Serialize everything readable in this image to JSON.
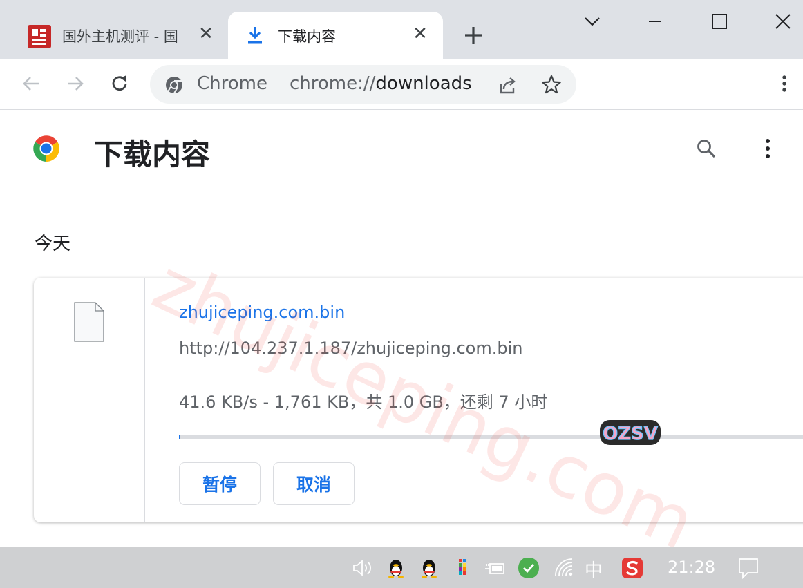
{
  "tabs": [
    {
      "title": "国外主机测评 - 国",
      "close": "✕",
      "active": false
    },
    {
      "title": "下载内容",
      "close": "✕",
      "active": true
    }
  ],
  "toolbar": {
    "chip_label": "Chrome",
    "url_scheme": "chrome://",
    "url_host": "downloads"
  },
  "page": {
    "title": "下载内容",
    "section": "今天"
  },
  "download": {
    "file_name": "zhujiceping.com.bin",
    "url": "http://104.237.1.187/zhujiceping.com.bin",
    "status": "41.6 KB/s - 1,761 KB，共 1.0 GB，还剩 7 小时",
    "progress_fraction": 0.0017,
    "pause_label": "暂停",
    "cancel_label": "取消"
  },
  "watermark": "zhujiceping.com",
  "logo_text": "OZSV",
  "taskbar": {
    "ime": "中",
    "clock": "21:28"
  },
  "colors": {
    "accent": "#1a73e8",
    "tabstrip": "#dee1e6",
    "taskbar": "#cfd0d2"
  }
}
